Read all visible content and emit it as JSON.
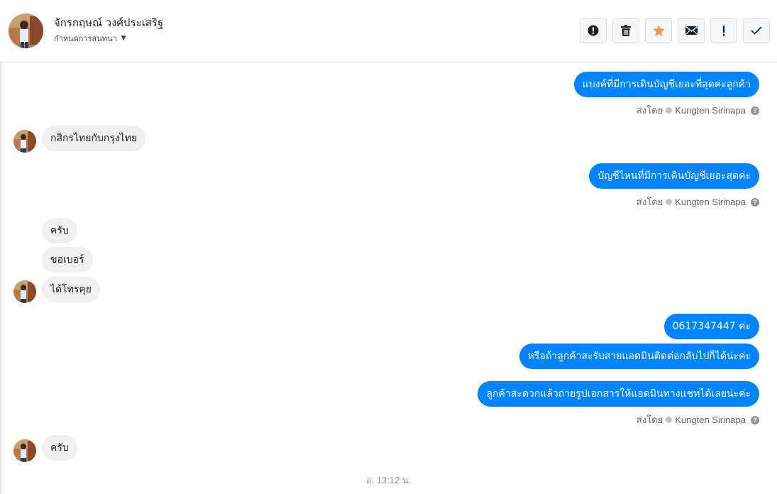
{
  "header": {
    "contact_name": "จักรกฤษณ์ วงศ์ประเสริฐ",
    "assign_label": "กำหนดการสนทนา"
  },
  "toolbar": {
    "buttons": [
      {
        "name": "spam-report-button",
        "icon": "exclamation-circle-icon"
      },
      {
        "name": "delete-button",
        "icon": "trash-icon"
      },
      {
        "name": "star-button",
        "icon": "star-icon",
        "color": "#f7923b"
      },
      {
        "name": "mark-unread-button",
        "icon": "envelope-icon"
      },
      {
        "name": "follow-up-button",
        "icon": "exclamation-icon",
        "label": "!"
      },
      {
        "name": "mark-done-button",
        "icon": "checkmark-icon"
      }
    ]
  },
  "messages": [
    {
      "direction": "out",
      "text": "แบงค์ที่มีการเดินบัญชีเยอะที่สุดค่ะลูกค้า"
    },
    {
      "direction": "in",
      "text": "กสิกรไทยกับกรุงไทย"
    },
    {
      "direction": "out",
      "text": "บัญชีไหนที่มีการเดินบัญชีเยอะสุดค่ะ"
    },
    {
      "direction": "in",
      "text": "ครับ"
    },
    {
      "direction": "in",
      "text": "ขอเบอร์"
    },
    {
      "direction": "in",
      "text": "ได้โทรคุย"
    },
    {
      "direction": "out",
      "text": "0617347447 ค่ะ"
    },
    {
      "direction": "out",
      "text": "หรือถ้าลูกค้าสะรับสายแอดมินติดต่อกลับไปก็ได้น่ะค่ะ"
    },
    {
      "direction": "out",
      "text": "ลูกค้าสะดวกแล้วถ่ายรูปเอกสารให้แอดมินทางแชทได้เลยน่ะค่ะ"
    },
    {
      "direction": "in",
      "text": "ครับ"
    }
  ],
  "sent_by": {
    "prefix": "ส่งโดย",
    "agent": "Kungten Sirinapa",
    "help": "?"
  },
  "timestamp": "อ. 13:12 น.",
  "colors": {
    "outgoing_bubble": "#0084ff",
    "incoming_bubble": "#f1f0f0",
    "star": "#f7923b"
  }
}
